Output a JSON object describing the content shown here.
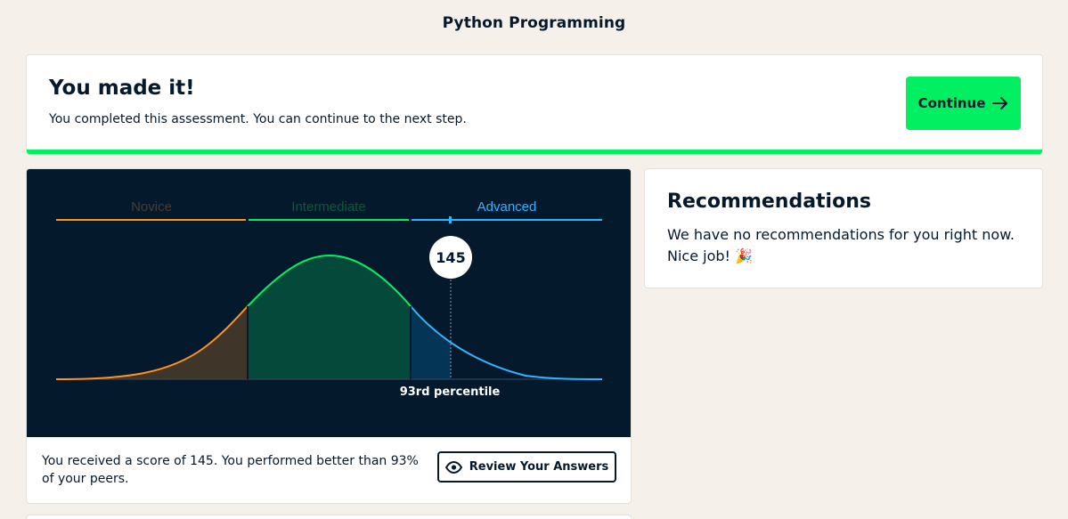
{
  "header": {
    "title": "Python Programming"
  },
  "banner": {
    "heading": "You made it!",
    "subtitle": "You completed this assessment. You can continue to the next step.",
    "continue_label": "Continue",
    "accent": "#03ef62"
  },
  "score_card": {
    "chart": {
      "levels": [
        {
          "label": "Novice",
          "color": "#ff931e"
        },
        {
          "label": "Intermediate",
          "color": "#03ef62"
        },
        {
          "label": "Advanced",
          "color": "#2fb4ff"
        }
      ],
      "score": "145",
      "percentile_label": "93rd percentile",
      "background": "#05192d"
    },
    "summary": "You received a score of 145. You performed better than 93% of your peers.",
    "review_label": "Review Your Answers",
    "review_icon": "eye-icon"
  },
  "recommendations": {
    "title": "Recommendations",
    "body": "We have no recommendations for you right now. Nice job! 🎉"
  }
}
